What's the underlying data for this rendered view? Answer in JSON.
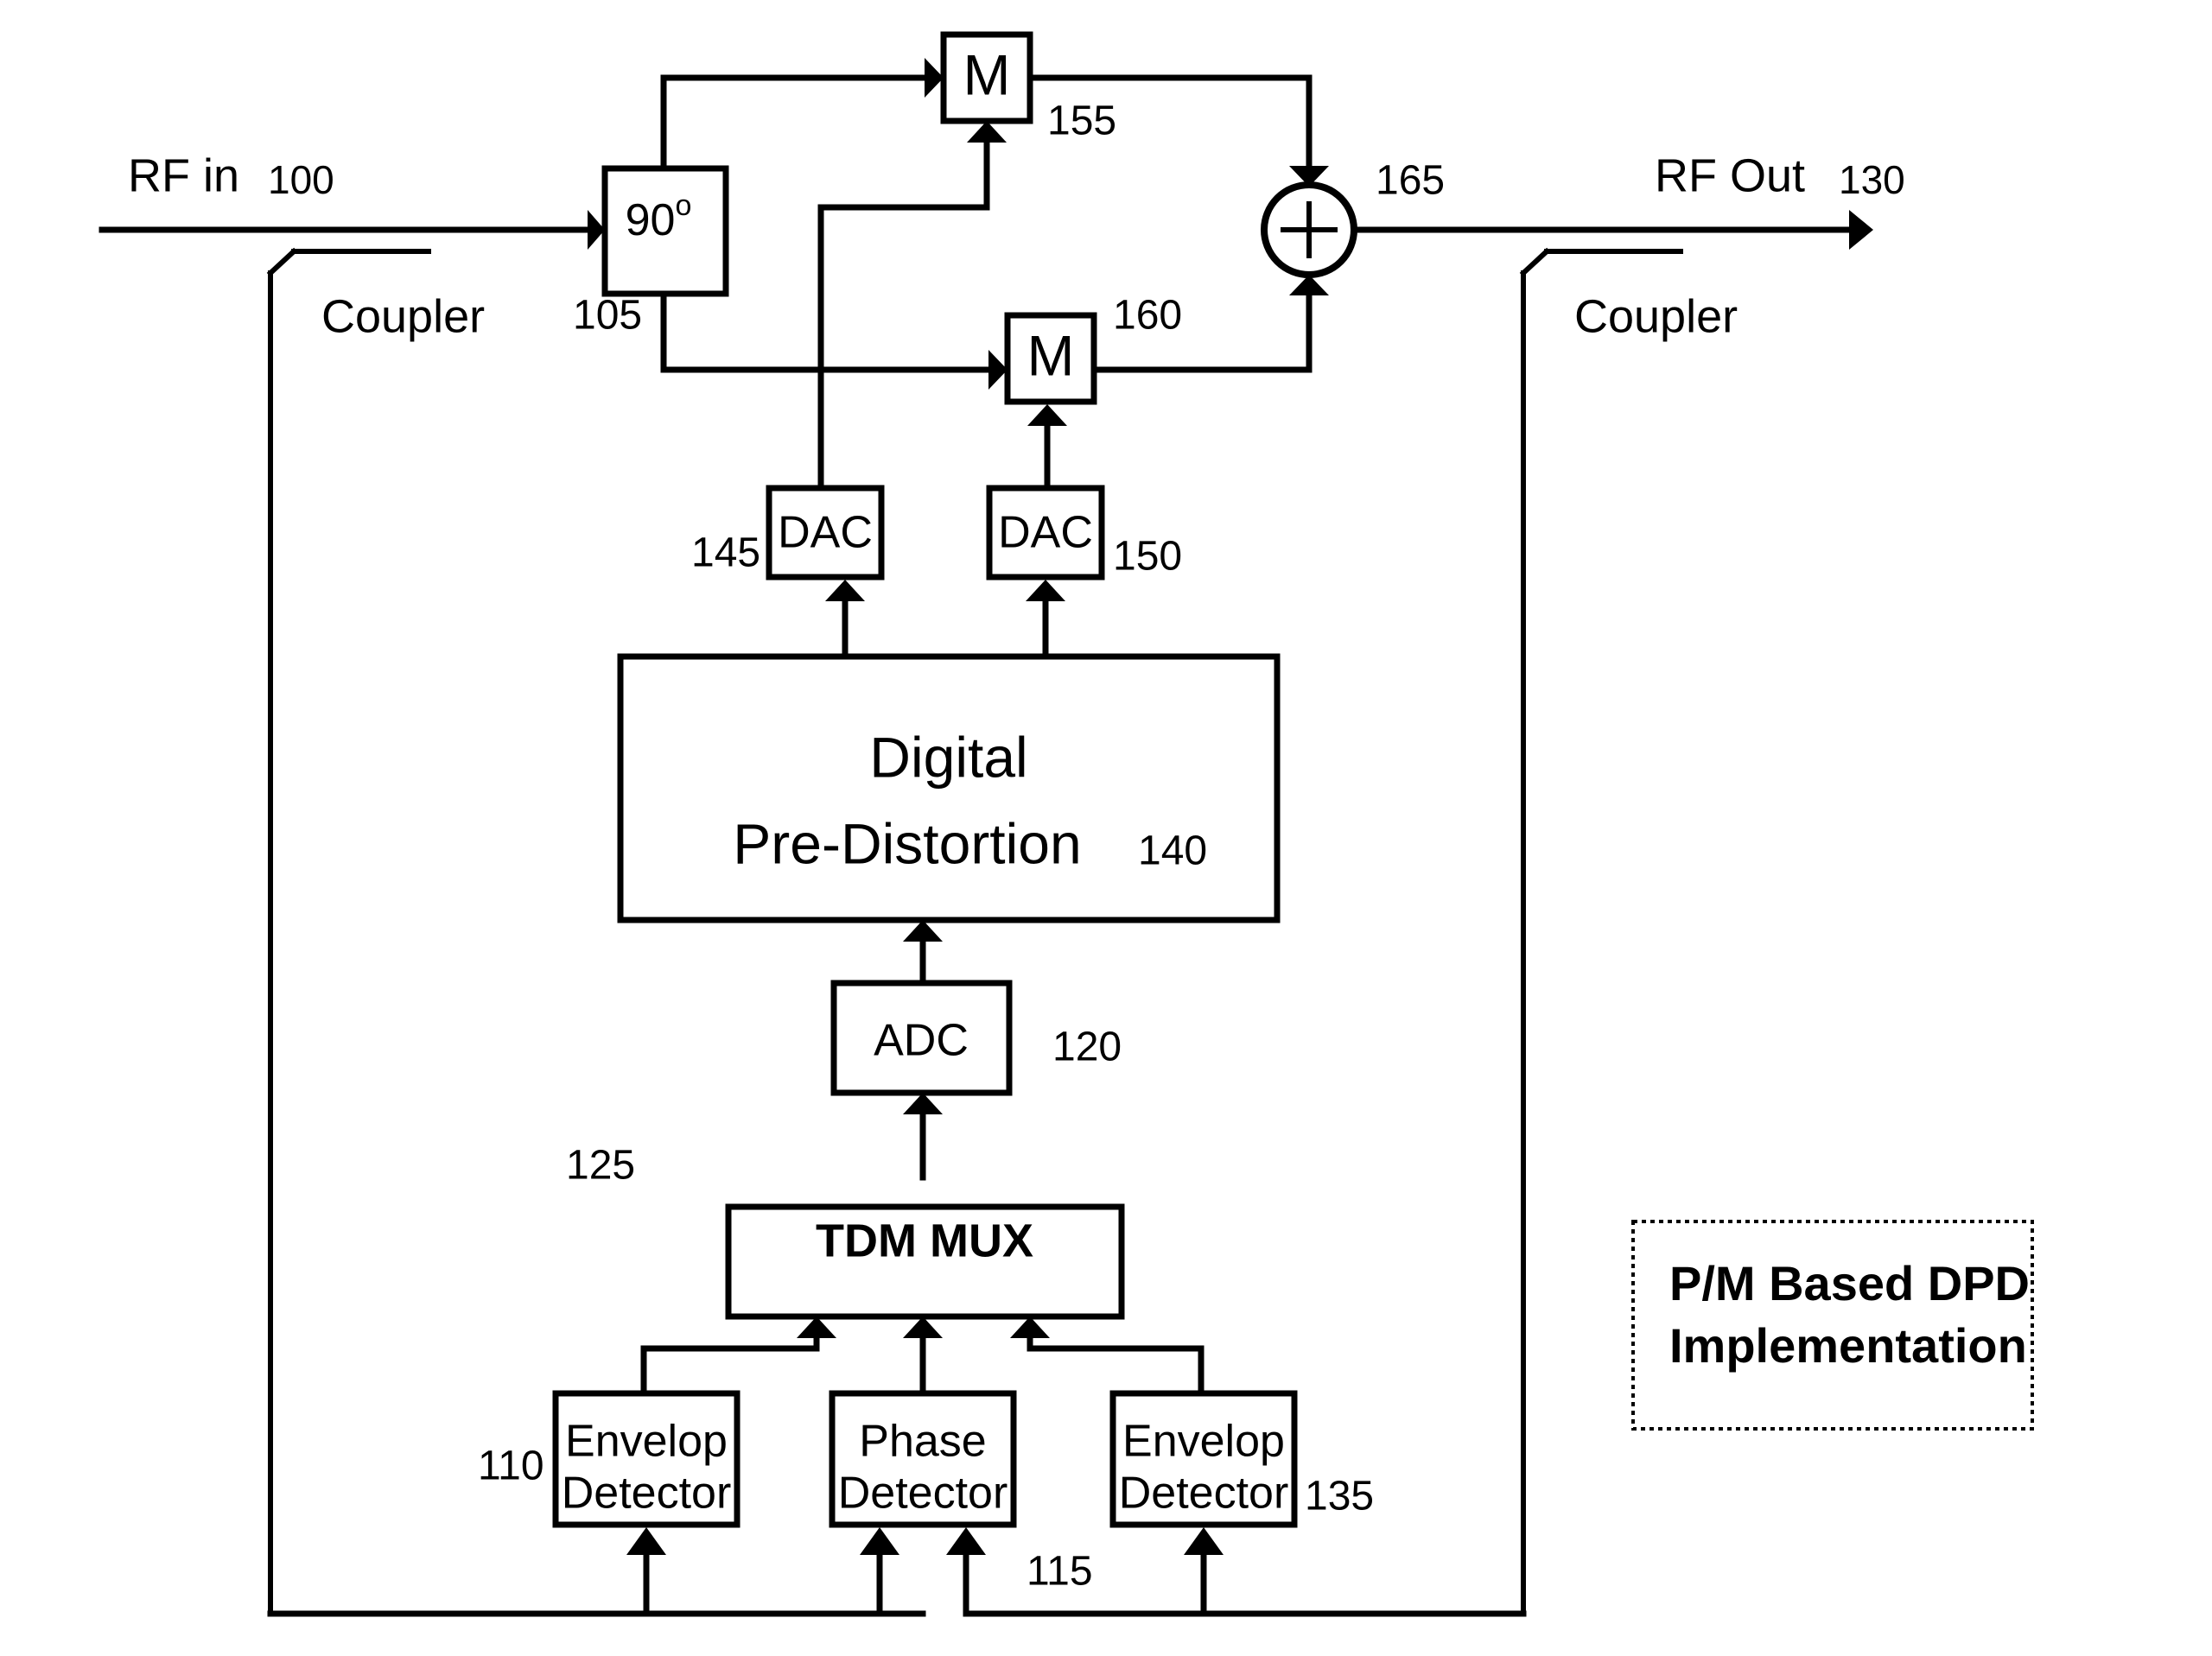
{
  "diagram": {
    "title_caption": {
      "line1": "P/M Based DPD",
      "line2": "Implementation"
    },
    "ports": {
      "rf_in_label": "RF in",
      "rf_in_ref": "100",
      "rf_out_label": "RF Out",
      "rf_out_ref": "130"
    },
    "couplers": {
      "input_label": "Coupler",
      "output_label": "Coupler"
    },
    "blocks": [
      {
        "id": "hybrid",
        "label": "90",
        "superscript": "o",
        "ref": "105"
      },
      {
        "id": "mixer_top",
        "label": "M",
        "ref": "155"
      },
      {
        "id": "mixer_bottom",
        "label": "M",
        "ref": "160"
      },
      {
        "id": "summer",
        "label": "+",
        "ref": "165"
      },
      {
        "id": "dac_left",
        "label": "DAC",
        "ref": "145"
      },
      {
        "id": "dac_right",
        "label": "DAC",
        "ref": "150"
      },
      {
        "id": "dpd",
        "label_line1": "Digital",
        "label_line2": "Pre-Distortion",
        "ref": "140"
      },
      {
        "id": "adc",
        "label": "ADC",
        "ref": "120"
      },
      {
        "id": "tdm_mux",
        "label": "TDM MUX",
        "ref": "125"
      },
      {
        "id": "envelope_detector_left",
        "label_line1": "Envelop",
        "label_line2": "Detector",
        "ref": "110"
      },
      {
        "id": "phase_detector",
        "label_line1": "Phase",
        "label_line2": "Detector",
        "ref": "115"
      },
      {
        "id": "envelope_detector_right",
        "label_line1": "Envelop",
        "label_line2": "Detector",
        "ref": "135"
      }
    ],
    "colors": {
      "line": "#000000",
      "background": "#ffffff",
      "text": "#000000"
    }
  }
}
